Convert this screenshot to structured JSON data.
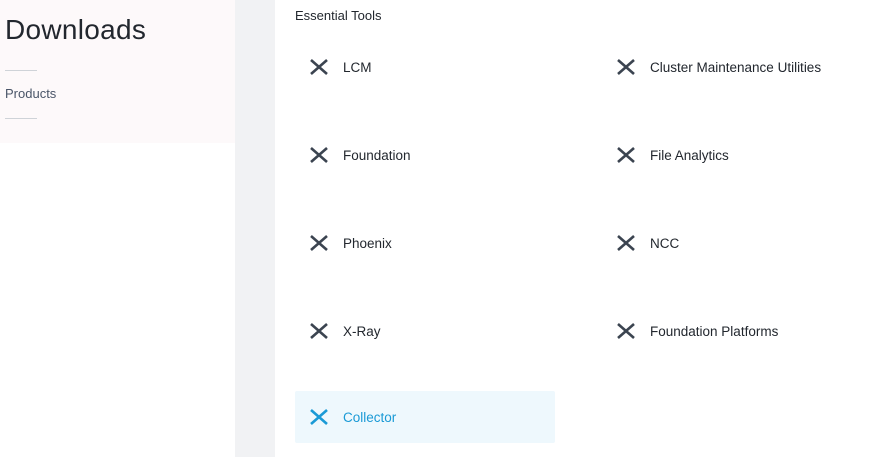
{
  "sidebar": {
    "title": "Downloads",
    "items": [
      {
        "label": "Products"
      }
    ]
  },
  "main": {
    "section_title": "Essential Tools",
    "tools": [
      {
        "label": "LCM",
        "icon": "nutanix-x-icon",
        "active": false
      },
      {
        "label": "Cluster Maintenance Utilities",
        "icon": "nutanix-x-icon",
        "active": false
      },
      {
        "label": "Foundation",
        "icon": "nutanix-x-icon",
        "active": false
      },
      {
        "label": "File Analytics",
        "icon": "nutanix-x-icon",
        "active": false
      },
      {
        "label": "Phoenix",
        "icon": "nutanix-x-icon",
        "active": false
      },
      {
        "label": "NCC",
        "icon": "nutanix-x-icon",
        "active": false
      },
      {
        "label": "X-Ray",
        "icon": "nutanix-x-icon",
        "active": false
      },
      {
        "label": "Foundation Platforms",
        "icon": "nutanix-x-icon",
        "active": false
      },
      {
        "label": "Collector",
        "icon": "nutanix-x-icon",
        "active": true
      }
    ]
  },
  "colors": {
    "text": "#22272e",
    "icon": "#3b4450",
    "accent": "#1a9ad6",
    "active_bg": "#eef8fd",
    "gutter": "#f1f2f4"
  }
}
